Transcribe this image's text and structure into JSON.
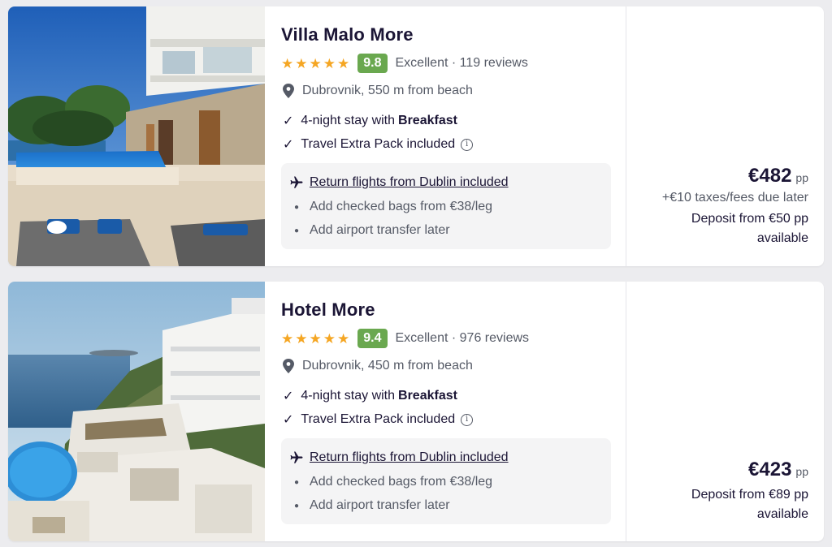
{
  "hotels": [
    {
      "name": "Villa Malo More",
      "stars": [
        "★",
        "★",
        "★",
        "★",
        "★"
      ],
      "score": "9.8",
      "rating_text": "Excellent · 119 reviews",
      "location": "Dubrovnik, 550 m from beach",
      "stay_prefix": "4-night stay with",
      "stay_board": "Breakfast",
      "extra_pack": "Travel Extra Pack included",
      "info_glyph": "i",
      "flights": "Return flights from Dublin included",
      "addon_bags": "Add checked bags from €38/leg",
      "addon_transfer": "Add airport transfer later",
      "price": "€482",
      "pp": "pp",
      "taxes": "+€10 taxes/fees due later",
      "deposit_line1": "Deposit from €50 pp",
      "deposit_line2": "available"
    },
    {
      "name": "Hotel More",
      "stars": [
        "★",
        "★",
        "★",
        "★",
        "★"
      ],
      "score": "9.4",
      "rating_text": "Excellent · 976 reviews",
      "location": "Dubrovnik, 450 m from beach",
      "stay_prefix": "4-night stay with",
      "stay_board": "Breakfast",
      "extra_pack": "Travel Extra Pack included",
      "info_glyph": "i",
      "flights": "Return flights from Dublin included",
      "addon_bags": "Add checked bags from €38/leg",
      "addon_transfer": "Add airport transfer later",
      "price": "€423",
      "pp": "pp",
      "deposit_line1": "Deposit from €89 pp",
      "deposit_line2": "available"
    }
  ],
  "icons": {
    "check": "✓",
    "bullet": "●",
    "location": "map-pin-icon",
    "flight": "airplane-icon",
    "info": "info-icon"
  },
  "colors": {
    "score_badge": "#6aa84f",
    "star": "#f5a623",
    "primary_text": "#1b1535",
    "secondary_text": "#555a66"
  }
}
